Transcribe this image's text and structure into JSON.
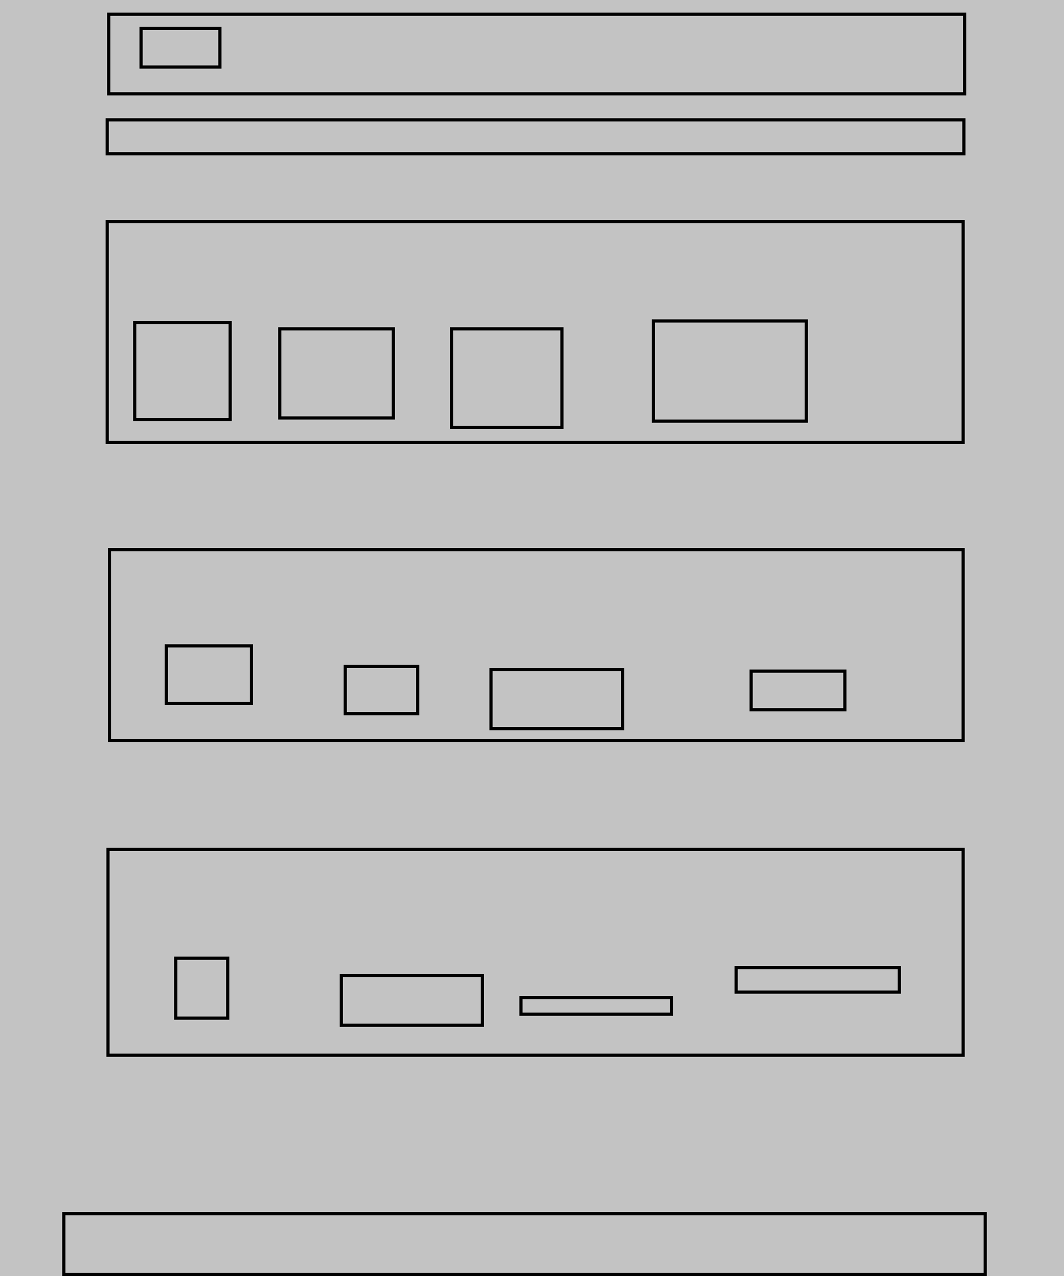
{
  "page": {
    "background": "#c3c3c3",
    "outline_color": "#000000"
  },
  "header": {
    "logo_text": ""
  },
  "nav_bar": {
    "text": ""
  },
  "section_1": {
    "items": [
      "",
      "",
      "",
      ""
    ]
  },
  "section_2": {
    "items": [
      "",
      "",
      "",
      ""
    ]
  },
  "section_3": {
    "items": [
      "",
      "",
      "",
      ""
    ]
  },
  "footer": {
    "text": ""
  }
}
